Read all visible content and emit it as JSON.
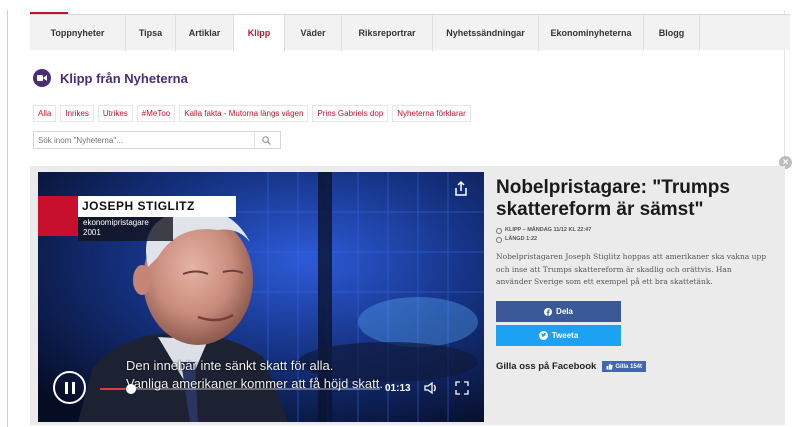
{
  "nav": {
    "tabs": [
      {
        "label": "Toppnyheter",
        "active": false
      },
      {
        "label": "Tipsa",
        "active": false
      },
      {
        "label": "Artiklar",
        "active": false
      },
      {
        "label": "Klipp",
        "active": true
      },
      {
        "label": "Väder",
        "active": false
      },
      {
        "label": "Riksreportrar",
        "active": false
      },
      {
        "label": "Nyhetssändningar",
        "active": false
      },
      {
        "label": "Ekonominyheterna",
        "active": false
      },
      {
        "label": "Blogg",
        "active": false
      }
    ]
  },
  "section": {
    "title": "Klipp från Nyheterna",
    "icon": "video-camera-icon"
  },
  "filters": [
    "Alla",
    "Inrikes",
    "Utrikes",
    "#MeToo",
    "Kalla fakta - Mutorna längs vägen",
    "Prins Gabriels dop",
    "Nyheterna förklarar"
  ],
  "search": {
    "placeholder": "Sök inom \"Nyheterna\"..."
  },
  "video": {
    "lower_third": {
      "name": "JOSEPH STIGLITZ",
      "role": "ekonomipristagare",
      "year": "2001"
    },
    "subtitle_line1": "Den innebär inte sänkt skatt för alla.",
    "subtitle_line2": "Vanliga amerikaner kommer att få höjd skatt.",
    "timecode": "01:13",
    "progress": 0.11
  },
  "article": {
    "headline": "Nobelpristagare: \"Trumps skattereform är sämst\"",
    "meta_date": "KLIPP – MÅNDAG 11/12 KL 22:47",
    "meta_length": "LÄNGD 1:22",
    "summary": "Nobelpristagaren Joseph Stiglitz hoppas att amerikaner ska vakna upp och inse att Trumps skattereform är skadlig och orättvis. Han använder Sverige som ett exempel på ett bra skattetänk.",
    "share_fb": "Dela",
    "share_tw": "Tweeta",
    "like_text": "Gilla oss på Facebook",
    "like_badge": "Gilla 154t"
  },
  "colors": {
    "accent_red": "#c8102e",
    "brand_purple": "#4b2d73",
    "facebook": "#3b5998",
    "twitter": "#1da1f2"
  }
}
